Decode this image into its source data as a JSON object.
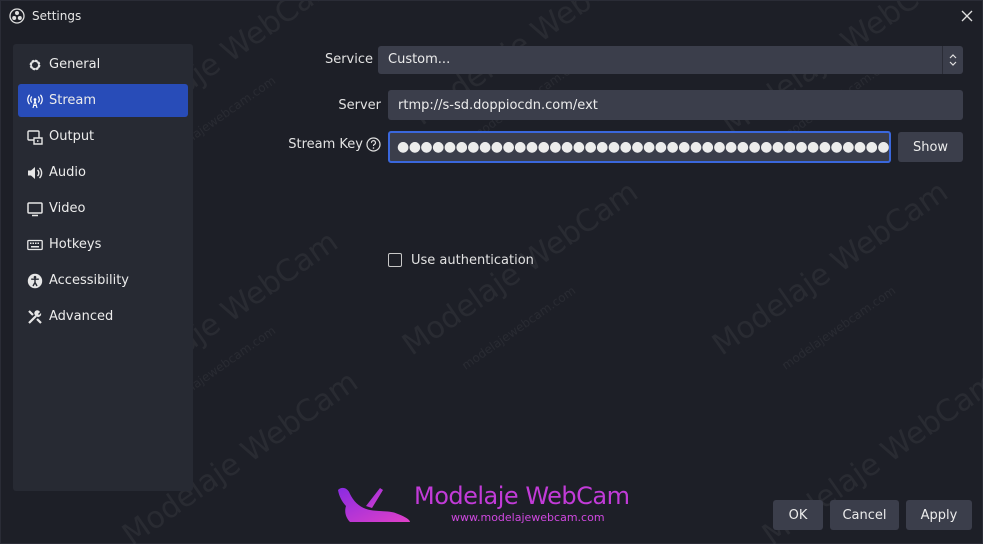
{
  "window": {
    "title": "Settings"
  },
  "sidebar": {
    "items": [
      {
        "label": "General",
        "icon": "gear-icon"
      },
      {
        "label": "Stream",
        "icon": "antenna-icon",
        "active": true
      },
      {
        "label": "Output",
        "icon": "output-icon"
      },
      {
        "label": "Audio",
        "icon": "speaker-icon"
      },
      {
        "label": "Video",
        "icon": "monitor-icon"
      },
      {
        "label": "Hotkeys",
        "icon": "keyboard-icon"
      },
      {
        "label": "Accessibility",
        "icon": "accessibility-icon"
      },
      {
        "label": "Advanced",
        "icon": "tools-icon"
      }
    ]
  },
  "stream": {
    "service_label": "Service",
    "service_value": "Custom...",
    "server_label": "Server",
    "server_value": "rtmp://s-sd.doppiocdn.com/ext",
    "key_label": "Stream Key",
    "key_value": "●●●●●●●●●●●●●●●●●●●●●●●●●●●●●●●●●●●●●●●●●●●●●●●●●●●●●●●●●●●●●●●",
    "show_label": "Show",
    "auth_label": "Use authentication",
    "auth_checked": false
  },
  "footer": {
    "ok_label": "OK",
    "cancel_label": "Cancel",
    "apply_label": "Apply"
  },
  "watermark": {
    "brand": "Modelaje WebCam",
    "url": "www.modelajewebcam.com",
    "repeat_text": "Modelaje WebCam",
    "repeat_small": "modelajewebcam.com"
  },
  "colors": {
    "background": "#1d1f27",
    "sidebar": "#272a33",
    "accent": "#284cb8",
    "input": "#3b3e4b",
    "focus_border": "#3a67dc",
    "logo": "#c23bd8"
  }
}
